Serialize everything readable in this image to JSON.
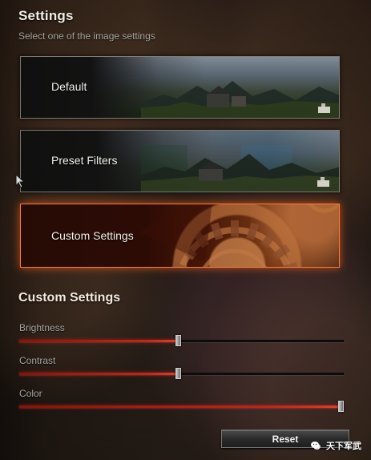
{
  "header": {
    "title": "Settings",
    "subtitle": "Select one of the image settings"
  },
  "options": [
    {
      "label": "Default",
      "selected": false,
      "icon": "landscape-preview"
    },
    {
      "label": "Preset Filters",
      "selected": false,
      "icon": "filter-preview"
    },
    {
      "label": "Custom Settings",
      "selected": true,
      "icon": "gear-preview"
    }
  ],
  "custom": {
    "title": "Custom Settings",
    "sliders": [
      {
        "label": "Brightness",
        "value": 0.49
      },
      {
        "label": "Contrast",
        "value": 0.49
      },
      {
        "label": "Color",
        "value": 0.99
      }
    ]
  },
  "reset_label": "Reset",
  "watermark": {
    "text": "天下军武",
    "icon": "wechat-icon"
  },
  "colors": {
    "selected_border": "#ff853f",
    "slider_fill": "#c1261a",
    "text_primary": "#f2f0ea",
    "text_secondary": "#a8a6a0"
  }
}
